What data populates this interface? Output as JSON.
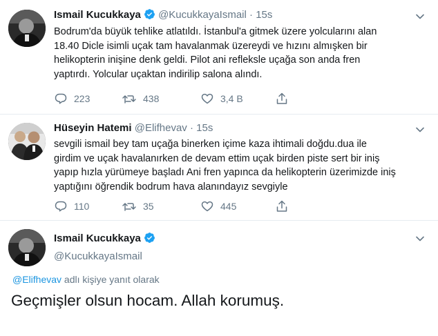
{
  "tweets": [
    {
      "author_name": "Ismail Kucukkaya",
      "handle": "@KucukkayaIsmail",
      "separator": "·",
      "time": "15s",
      "text_lines": [
        "Bodrum'da büyük tehlike atlatıldı. İstanbul'a gitmek üzere yolcularını alan",
        "18.40 Dicle isimli uçak tam havalanmak üzereydi ve hızını almışken bir",
        "helikopterin inişine denk geldi. Pilot ani refleksle uçağa son anda fren",
        "yaptırdı. Yolcular uçaktan indirilip salona alındı."
      ],
      "reply_count": "223",
      "retweet_count": "438",
      "like_count": "3,4 B",
      "verified": true
    },
    {
      "author_name": "Hüseyin Hatemi",
      "handle": "@Elifhevav",
      "separator": "·",
      "time": "15s",
      "text_lines": [
        "sevgili ismail bey tam uçağa binerken içime kaza ihtimali doğdu.dua ile",
        "girdim ve uçak havalanırken de devam ettim uçak birden piste sert bir iniş",
        "yapıp hızla yürümeye başladı Ani fren yapınca da helikopterin üzerimizde iniş",
        "yaptığını öğrendik  bodrum hava alanındayız sevgiyle"
      ],
      "reply_count": "110",
      "retweet_count": "35",
      "like_count": "445",
      "verified": false
    }
  ],
  "main_tweet": {
    "author_name": "Ismail Kucukkaya",
    "handle": "@KucukkayaIsmail",
    "reply_to_handle": "@Elifhevav",
    "reply_to_suffix": "adlı kişiye yanıt olarak",
    "text": "Geçmişler olsun hocam. Allah korumuş.",
    "verified": true
  },
  "colors": {
    "text": "#14171a",
    "muted": "#657786",
    "link": "#1b95e0",
    "verified": "#1da1f2",
    "divider": "#e6ecf0"
  },
  "icons": [
    "verified-badge-icon",
    "chevron-down-icon",
    "reply-icon",
    "retweet-icon",
    "like-icon",
    "share-icon"
  ]
}
